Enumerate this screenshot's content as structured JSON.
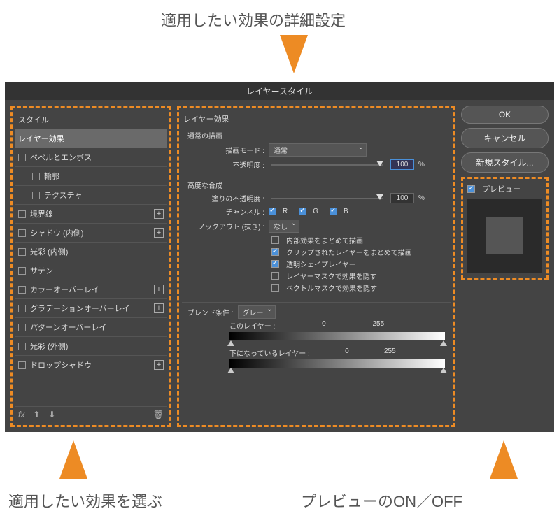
{
  "callouts": {
    "top": "適用したい効果の詳細設定",
    "bottom_left": "適用したい効果を選ぶ",
    "bottom_right": "プレビューのON／OFF"
  },
  "dialog": {
    "title": "レイヤースタイル"
  },
  "left": {
    "header": "スタイル",
    "items": [
      {
        "label": "レイヤー効果",
        "checkbox": false,
        "selected": true
      },
      {
        "label": "ベベルとエンボス",
        "checkbox": true
      },
      {
        "label": "輪郭",
        "checkbox": true,
        "sub": true
      },
      {
        "label": "テクスチャ",
        "checkbox": true,
        "sub": true
      },
      {
        "label": "境界線",
        "checkbox": true,
        "plus": true
      },
      {
        "label": "シャドウ (内側)",
        "checkbox": true,
        "plus": true
      },
      {
        "label": "光彩 (内側)",
        "checkbox": true
      },
      {
        "label": "サテン",
        "checkbox": true
      },
      {
        "label": "カラーオーバーレイ",
        "checkbox": true,
        "plus": true
      },
      {
        "label": "グラデーションオーバーレイ",
        "checkbox": true,
        "plus": true
      },
      {
        "label": "パターンオーバーレイ",
        "checkbox": true
      },
      {
        "label": "光彩 (外側)",
        "checkbox": true
      },
      {
        "label": "ドロップシャドウ",
        "checkbox": true,
        "plus": true
      }
    ],
    "fx": "fx"
  },
  "center": {
    "title": "レイヤー効果",
    "normal": {
      "title": "通常の描画",
      "blend_mode_label": "描画モード :",
      "blend_mode_value": "通常",
      "opacity_label": "不透明度 :",
      "opacity_value": "100",
      "percent": "%"
    },
    "advanced": {
      "title": "高度な合成",
      "fill_label": "塗りの不透明度 :",
      "fill_value": "100",
      "channel_label": "チャンネル :",
      "r": "R",
      "g": "G",
      "b": "B",
      "knockout_label": "ノックアウト (抜き) :",
      "knockout_value": "なし",
      "opts": [
        {
          "label": "内部効果をまとめて描画",
          "on": false
        },
        {
          "label": "クリップされたレイヤーをまとめて描画",
          "on": true
        },
        {
          "label": "透明シェイプレイヤー",
          "on": true
        },
        {
          "label": "レイヤーマスクで効果を隠す",
          "on": false
        },
        {
          "label": "ベクトルマスクで効果を隠す",
          "on": false
        }
      ]
    },
    "blendif": {
      "label": "ブレンド条件 :",
      "value": "グレー",
      "this_layer": "このレイヤー :",
      "underlying": "下になっているレイヤー :",
      "min": "0",
      "max": "255"
    }
  },
  "right": {
    "ok": "OK",
    "cancel": "キャンセル",
    "new_style": "新規スタイル...",
    "preview": "プレビュー"
  }
}
